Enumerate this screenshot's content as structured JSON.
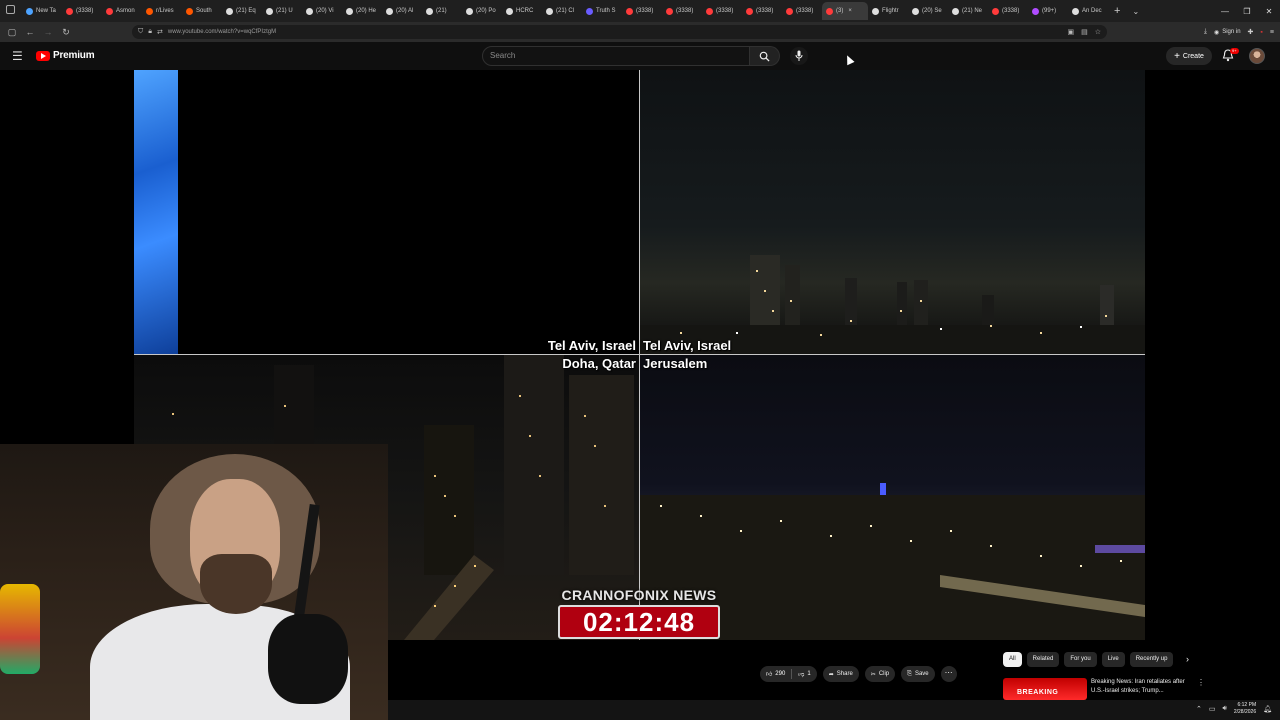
{
  "browser": {
    "tabs": [
      {
        "label": "New Ta",
        "color": "#4da3ff"
      },
      {
        "label": "(3338)",
        "color": "#ff3b3b"
      },
      {
        "label": "Asmon",
        "color": "#ff3b3b"
      },
      {
        "label": "r/Lives",
        "color": "#ff5700"
      },
      {
        "label": "South",
        "color": "#ff5700"
      },
      {
        "label": "(21) Eq",
        "color": "#dddddd"
      },
      {
        "label": "(21) U",
        "color": "#dddddd"
      },
      {
        "label": "(20) Vi",
        "color": "#dddddd"
      },
      {
        "label": "(20) He",
        "color": "#dddddd"
      },
      {
        "label": "(20) Al",
        "color": "#dddddd"
      },
      {
        "label": "(21)",
        "color": "#dddddd"
      },
      {
        "label": "(20) Po",
        "color": "#dddddd"
      },
      {
        "label": "HCRC",
        "color": "#dddddd"
      },
      {
        "label": "(21) Cl",
        "color": "#dddddd"
      },
      {
        "label": "Truth S",
        "color": "#6a5cff"
      },
      {
        "label": "(3338)",
        "color": "#ff3b3b"
      },
      {
        "label": "(3338)",
        "color": "#ff3b3b"
      },
      {
        "label": "(3338)",
        "color": "#ff3b3b"
      },
      {
        "label": "(3338)",
        "color": "#ff3b3b"
      },
      {
        "label": "(3338)",
        "color": "#ff3b3b"
      },
      {
        "label": "(3)",
        "color": "#ff3b3b",
        "active": true
      },
      {
        "label": "Flightr",
        "color": "#dddddd"
      },
      {
        "label": "(20) Se",
        "color": "#dddddd"
      },
      {
        "label": "(21) Ne",
        "color": "#dddddd"
      },
      {
        "label": "(3338)",
        "color": "#ff3b3b"
      },
      {
        "label": "(99+)",
        "color": "#b04cff"
      },
      {
        "label": "An Dec",
        "color": "#dddddd"
      }
    ],
    "url": "www.youtube.com/watch?v=wqCfPIztgM",
    "signin_label": "Sign in"
  },
  "youtube": {
    "logo_text": "Premium",
    "search_placeholder": "Search",
    "create_label": "Create",
    "notification_badge": "9+"
  },
  "video": {
    "captions": {
      "top_left": "Tel Aviv, Israel",
      "top_right": "Tel Aviv, Israel",
      "bottom_left": "Doha, Qatar",
      "bottom_right": "Jerusalem"
    },
    "news_label": "CRANNOFONIX NEWS",
    "timer": "02:12:48"
  },
  "actions": {
    "likes": "290",
    "dislikes": "1",
    "share": "Share",
    "clip": "Clip",
    "save": "Save"
  },
  "chips": [
    "All",
    "Related",
    "For you",
    "Live",
    "Recently up"
  ],
  "recommendation": {
    "thumb_text": "BREAKING",
    "title": "Breaking News: Iran retaliates after U.S.-Israel strikes; Trump..."
  },
  "taskbar": {
    "time": "6:12 PM",
    "date": "2/28/2026"
  },
  "colors": {
    "accent_red": "#ff0000",
    "timer_bg": "#b00010"
  }
}
